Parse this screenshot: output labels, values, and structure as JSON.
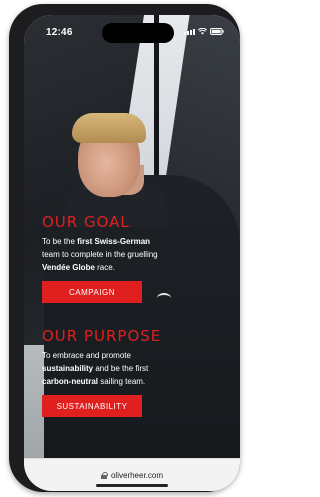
{
  "status": {
    "time": "12:46"
  },
  "goal": {
    "heading": "OUR GOAL",
    "line1_a": "To be the ",
    "line1_b": "first Swiss-German",
    "line2": "team to complete in the gruelling",
    "line3_b": "Vendée Globe",
    "line3_c": " race.",
    "button": "CAMPAIGN"
  },
  "purpose": {
    "heading": "OUR PURPOSE",
    "line1": "To embrace and promote",
    "line2_b": "sustainability",
    "line2_c": " and be the first",
    "line3_b": "carbon-neutral",
    "line3_c": " sailing team.",
    "button": "SUSTAINABILITY"
  },
  "urlbar": {
    "url": "oliverheer.com"
  },
  "colors": {
    "accent": "#e0201f"
  }
}
